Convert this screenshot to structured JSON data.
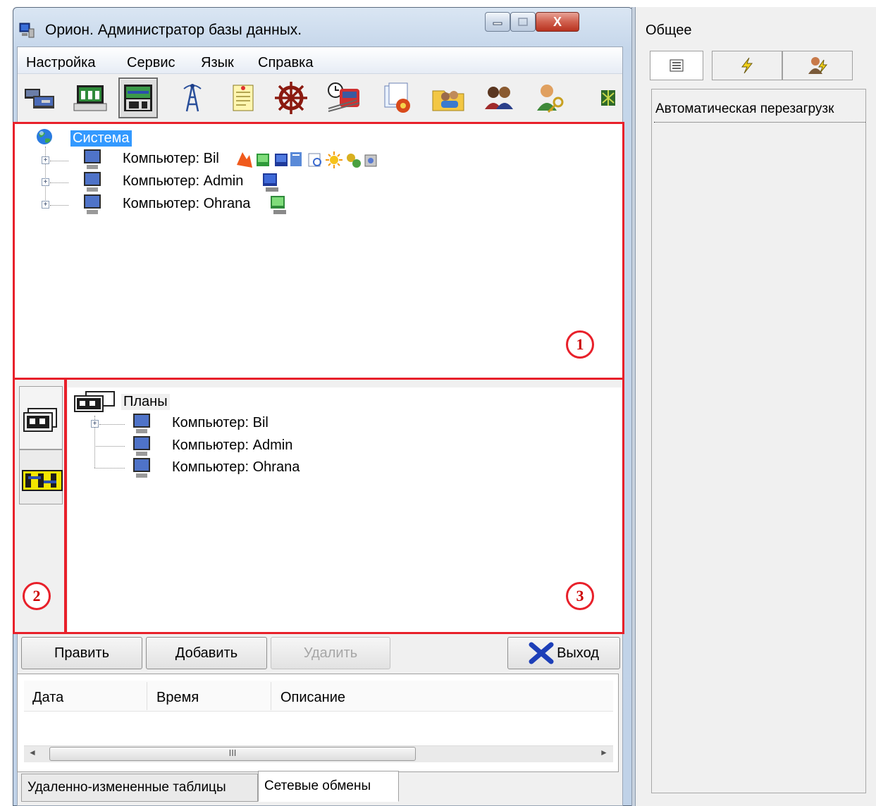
{
  "window": {
    "title": "Орион. Администратор базы данных.",
    "close_glyph": "X"
  },
  "menu": {
    "items": [
      "Настройка",
      "Сервис",
      "Язык",
      "Справка"
    ]
  },
  "toolbar": {
    "icons": [
      "computers-icon",
      "network-icon",
      "plans-icon",
      "antenna-icon",
      "notes-icon",
      "helm-icon",
      "train-schedule-icon",
      "documents-icon",
      "folder-users-icon",
      "users-icon",
      "user-key-icon",
      "map-icon"
    ],
    "active": "plans-icon"
  },
  "tree1": {
    "root": "Система",
    "nodes": [
      "Компьютер: Bil",
      "Компьютер: Admin",
      "Компьютер: Ohrana"
    ],
    "expander": "+"
  },
  "tree2": {
    "root": "Планы",
    "nodes": [
      "Компьютер: Bil",
      "Компьютер: Admin",
      "Компьютер: Ohrana"
    ],
    "expander": "+"
  },
  "annotations": [
    "1",
    "2",
    "3"
  ],
  "buttons": {
    "edit": "Править",
    "add": "Добавить",
    "delete": "Удалить",
    "exit": "Выход"
  },
  "grid": {
    "columns": [
      "Дата",
      "Время",
      "Описание"
    ],
    "scroll_thumb": "III",
    "scroll_left": "◄",
    "scroll_right": "►"
  },
  "bottom_tabs": [
    "Удаленно-измененные таблицы",
    "Сетевые обмены"
  ],
  "bottom_tab_active": "Сетевые обмены",
  "right_panel": {
    "title": "Общее",
    "tabs": [
      "list-icon",
      "lightning-icon",
      "user-lightning-icon"
    ],
    "field": "Автоматическая перезагрузк"
  },
  "colors": {
    "annotation_red": "#e8202a",
    "selection": "#3399ff",
    "close_button": "#c8473a"
  }
}
